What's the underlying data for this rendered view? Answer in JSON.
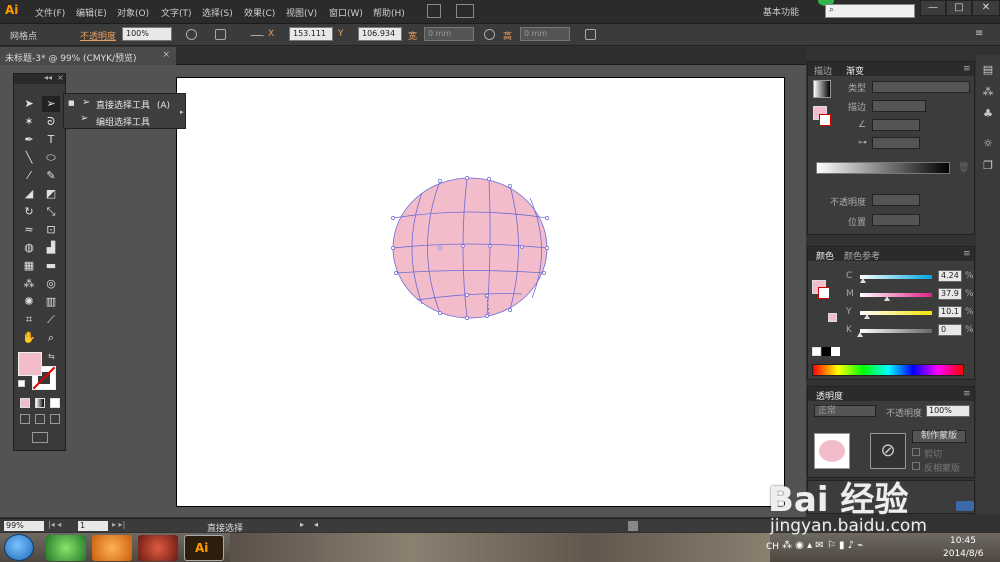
{
  "menubar": {
    "logo": "Ai",
    "items": [
      "文件(F)",
      "编辑(E)",
      "对象(O)",
      "文字(T)",
      "选择(S)",
      "效果(C)",
      "视图(V)",
      "窗口(W)",
      "帮助(H)"
    ],
    "workspace": "基本功能",
    "search_placeholder": "",
    "minimize": "—",
    "maximize": "□",
    "close": "✕"
  },
  "controlbar": {
    "selection_label": "网格点",
    "opacity_label": "不透明度",
    "opacity_value": "100%",
    "x_label": "X",
    "x_value": "153.111",
    "y_label": "Y",
    "y_value": "106.934",
    "w_label": "宽",
    "w_value": "0 mm",
    "h_label": "高",
    "h_value": "0 mm"
  },
  "document": {
    "tab_title": "未标题-3* @ 99% (CMYK/预览)",
    "close": "×"
  },
  "flyout": {
    "items": [
      {
        "label": "直接选择工具",
        "shortcut": "(A)"
      },
      {
        "label": "编组选择工具",
        "shortcut": ""
      }
    ]
  },
  "gradient_panel": {
    "tabs": [
      "描边",
      "渐变"
    ],
    "type_label": "类型",
    "stroke_label": "描边",
    "opacity_label": "不透明度",
    "position_label": "位置"
  },
  "color_panel": {
    "tabs": [
      "颜色",
      "颜色参考"
    ],
    "channels": [
      {
        "label": "C",
        "value": "4.24",
        "color": "#00a6e0",
        "pct": 0.04
      },
      {
        "label": "M",
        "value": "37.9",
        "color": "#e0218a",
        "pct": 0.38
      },
      {
        "label": "Y",
        "value": "10.1",
        "color": "#f7e200",
        "pct": 0.1
      },
      {
        "label": "K",
        "value": "0",
        "color": "#666666",
        "pct": 0.0
      }
    ],
    "unit": "%",
    "fill_color": "#f2bccb"
  },
  "transparency_panel": {
    "tab": "透明度",
    "blend_mode": "正常",
    "opacity_label": "不透明度",
    "opacity_value": "100%",
    "make_mask": "制作蒙版",
    "clip": "剪切",
    "invert_mask": "反相蒙版"
  },
  "statusbar": {
    "zoom": "99%",
    "page": "1",
    "tool_name": "直接选择"
  },
  "taskbar": {
    "ime": "CH",
    "time": "10:45",
    "date": "2014/8/6"
  },
  "watermark": {
    "brand": "Bai 经验",
    "url": "jingyan.baidu.com"
  },
  "artwork": {
    "fill": "#f2bccb",
    "mesh_color": "#6b6bd6"
  }
}
